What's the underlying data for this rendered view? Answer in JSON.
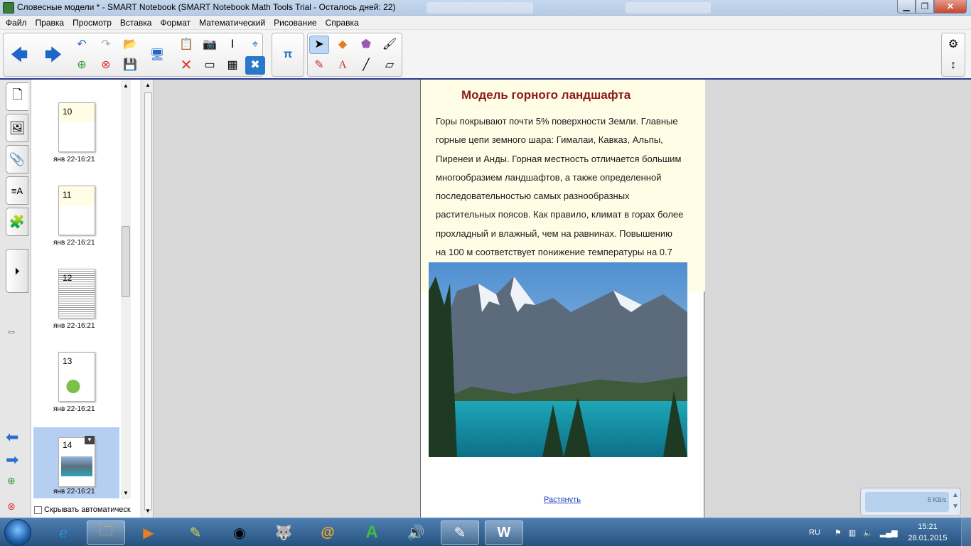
{
  "window": {
    "title": "Словесные модели * - SMART Notebook (SMART Notebook Math Tools Trial - Осталось дней: 22)"
  },
  "menu": [
    "Файл",
    "Правка",
    "Просмотр",
    "Вставка",
    "Формат",
    "Математический",
    "Рисование",
    "Справка"
  ],
  "sorter": {
    "pages": [
      {
        "num": "10",
        "date": "янв 22-16:21"
      },
      {
        "num": "11",
        "date": "янв 22-16:21"
      },
      {
        "num": "12",
        "date": "янв 22-16:21"
      },
      {
        "num": "13",
        "date": "янв 22-16:21"
      },
      {
        "num": "14",
        "date": "янв 22-16:21",
        "selected": true
      }
    ],
    "auto_hide_label": "Скрывать автоматическ"
  },
  "page": {
    "title": "Модель горного ландшафта",
    "body_lines": [
      "Горы покрывают почти 5% поверхности Земли. Главные",
      "горные цепи земного шара: Гималаи, Кавказ, Альпы,",
      "Пиренеи и Анды. Горная местность отличается большим",
      "многообразием ландшафтов, а также определенной",
      "последовательностью самых разнообразных",
      "растительных поясов. Как правило, климат в горах более",
      "прохладный и влажный, чем на равнинах. Повышению",
      "на 100 м соответствует понижение температуры на 0.7"
    ],
    "stretch_link": "Растянуть"
  },
  "net_widget": {
    "speed": "5 KB/s"
  },
  "taskbar": {
    "lang": "RU",
    "time": "15:21",
    "date": "28.01.2015"
  },
  "colors": {
    "title_red": "#8b1a1a",
    "link_blue": "#1a3fbf",
    "selection": "#b5cff2"
  }
}
